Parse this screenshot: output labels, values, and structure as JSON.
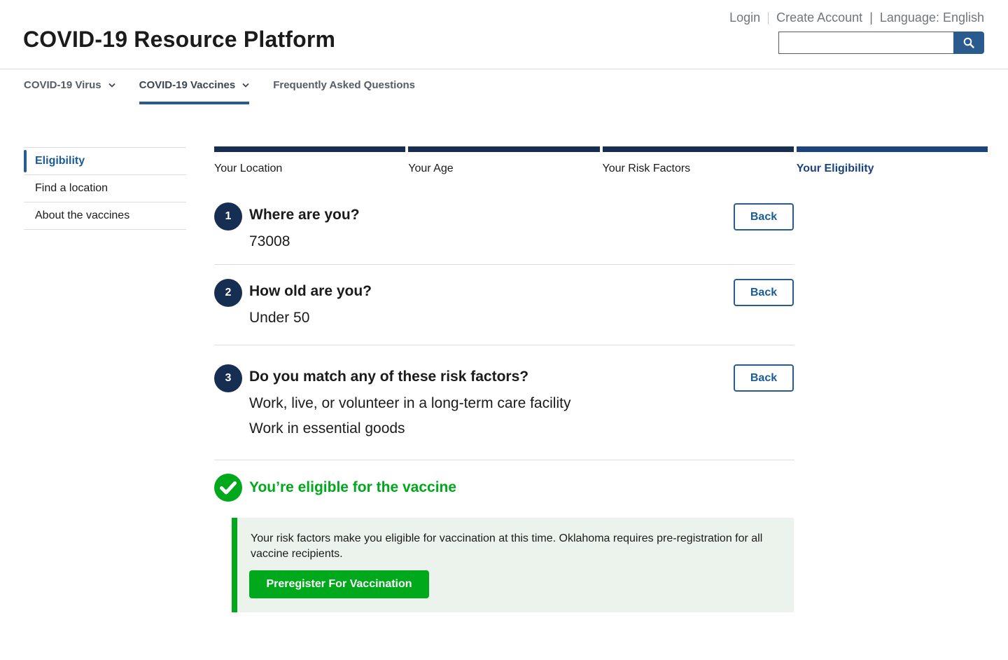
{
  "header": {
    "site_title": "COVID-19 Resource Platform",
    "login": "Login",
    "create_account": "Create Account",
    "language_separator": "|",
    "language": "Language: English",
    "search_placeholder": "",
    "search_icon": "search-icon"
  },
  "primary_nav": {
    "items": [
      {
        "label": "COVID-19 Virus",
        "has_dropdown": true,
        "active": false
      },
      {
        "label": "COVID-19 Vaccines",
        "has_dropdown": true,
        "active": true
      },
      {
        "label": "Frequently Asked Questions",
        "has_dropdown": false,
        "active": false
      }
    ]
  },
  "sidenav": {
    "items": [
      {
        "label": "Eligibility",
        "current": true
      },
      {
        "label": "Find a location",
        "current": false
      },
      {
        "label": "About the vaccines",
        "current": false
      }
    ]
  },
  "steps": [
    {
      "label": "Your Location",
      "current": false
    },
    {
      "label": "Your Age",
      "current": false
    },
    {
      "label": "Your Risk Factors",
      "current": false
    },
    {
      "label": "Your Eligibility",
      "current": true
    }
  ],
  "questions": [
    {
      "number": "1",
      "title": "Where are you?",
      "answers": [
        "73008"
      ],
      "back_label": "Back"
    },
    {
      "number": "2",
      "title": "How old are you?",
      "answers": [
        "Under 50"
      ],
      "back_label": "Back"
    },
    {
      "number": "3",
      "title": "Do you match any of these risk factors?",
      "answers": [
        "Work, live, or volunteer in a long-term care facility",
        "Work in essential goods"
      ],
      "back_label": "Back"
    }
  ],
  "result": {
    "icon": "check-circle-icon",
    "title": "You’re eligible for the vaccine",
    "message": "Your risk factors make you eligible for vaccination at this time. Oklahoma requires pre-registration for all vaccine recipients.",
    "button_label": "Preregister For Vaccination"
  },
  "colors": {
    "primary": "#2a5b8f",
    "step_bar": "#162e51",
    "success": "#00a91c",
    "alert_bg": "#ecf3ec"
  }
}
